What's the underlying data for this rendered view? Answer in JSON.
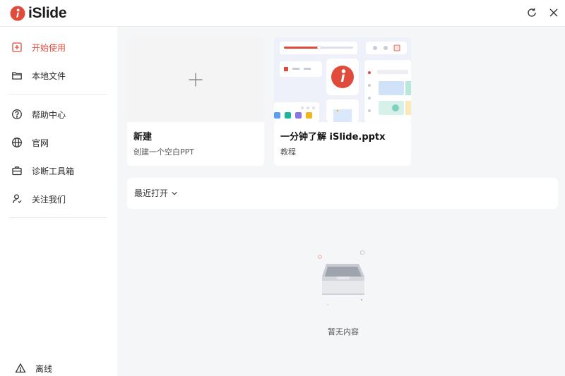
{
  "app": {
    "name": "iSlide"
  },
  "window": {
    "refresh_icon": "refresh-icon",
    "close_icon": "close-icon"
  },
  "sidebar": {
    "items": [
      {
        "label": "开始使用",
        "icon": "plus-square-icon",
        "active": true
      },
      {
        "label": "本地文件",
        "icon": "folder-icon",
        "active": false
      },
      {
        "label": "帮助中心",
        "icon": "question-circle-icon",
        "active": false
      },
      {
        "label": "官网",
        "icon": "globe-icon",
        "active": false
      },
      {
        "label": "诊断工具箱",
        "icon": "toolbox-icon",
        "active": false
      },
      {
        "label": "关注我们",
        "icon": "user-icon",
        "active": false
      }
    ],
    "offline": {
      "label": "离线",
      "icon": "warning-icon"
    }
  },
  "cards": [
    {
      "title": "新建",
      "subtitle": "创建一个空白PPT"
    },
    {
      "title": "一分钟了解 iSlide.pptx",
      "subtitle": "教程"
    }
  ],
  "recent": {
    "label": "最近打开"
  },
  "empty_state": {
    "text": "暂无内容"
  },
  "colors": {
    "accent": "#e14b3c",
    "main_bg": "#f5f6f8"
  }
}
